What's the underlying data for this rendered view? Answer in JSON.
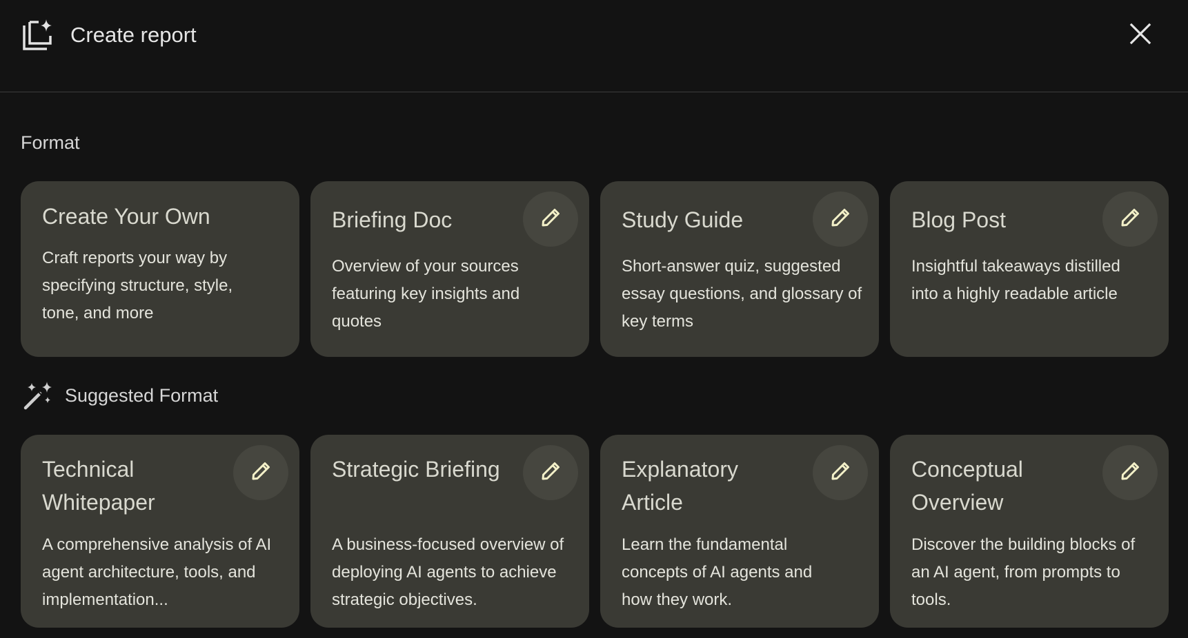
{
  "header": {
    "title": "Create report",
    "icon": "create-report-icon",
    "close_icon": "close-icon"
  },
  "format_section": {
    "label": "Format",
    "cards": [
      {
        "title": "Create Your Own",
        "description": "Craft reports your way by specifying structure, style, tone, and more",
        "editable": false
      },
      {
        "title": "Briefing Doc",
        "description": "Overview of your sources featuring key insights and quotes",
        "editable": true
      },
      {
        "title": "Study Guide",
        "description": "Short-answer quiz, suggested essay questions, and glossary of key terms",
        "editable": true
      },
      {
        "title": "Blog Post",
        "description": "Insightful takeaways distilled into a highly readable article",
        "editable": true
      }
    ]
  },
  "suggested_section": {
    "label": "Suggested Format",
    "icon": "magic-wand-icon",
    "cards": [
      {
        "title": "Technical Whitepaper",
        "description": "A comprehensive analysis of AI agent architecture, tools, and implementation...",
        "editable": true
      },
      {
        "title": "Strategic Briefing",
        "description": "A business-focused overview of deploying AI agents to achieve strategic objectives.",
        "editable": true
      },
      {
        "title": "Explanatory Article",
        "description": "Learn the fundamental concepts of AI agents and how they work.",
        "editable": true
      },
      {
        "title": "Conceptual Overview",
        "description": "Discover the building blocks of an AI agent, from prompts to tools.",
        "editable": true
      }
    ]
  },
  "colors": {
    "background": "#131313",
    "card": "#3a3a34",
    "edit_button": "#46463f",
    "pencil": "#f3f0c8"
  }
}
